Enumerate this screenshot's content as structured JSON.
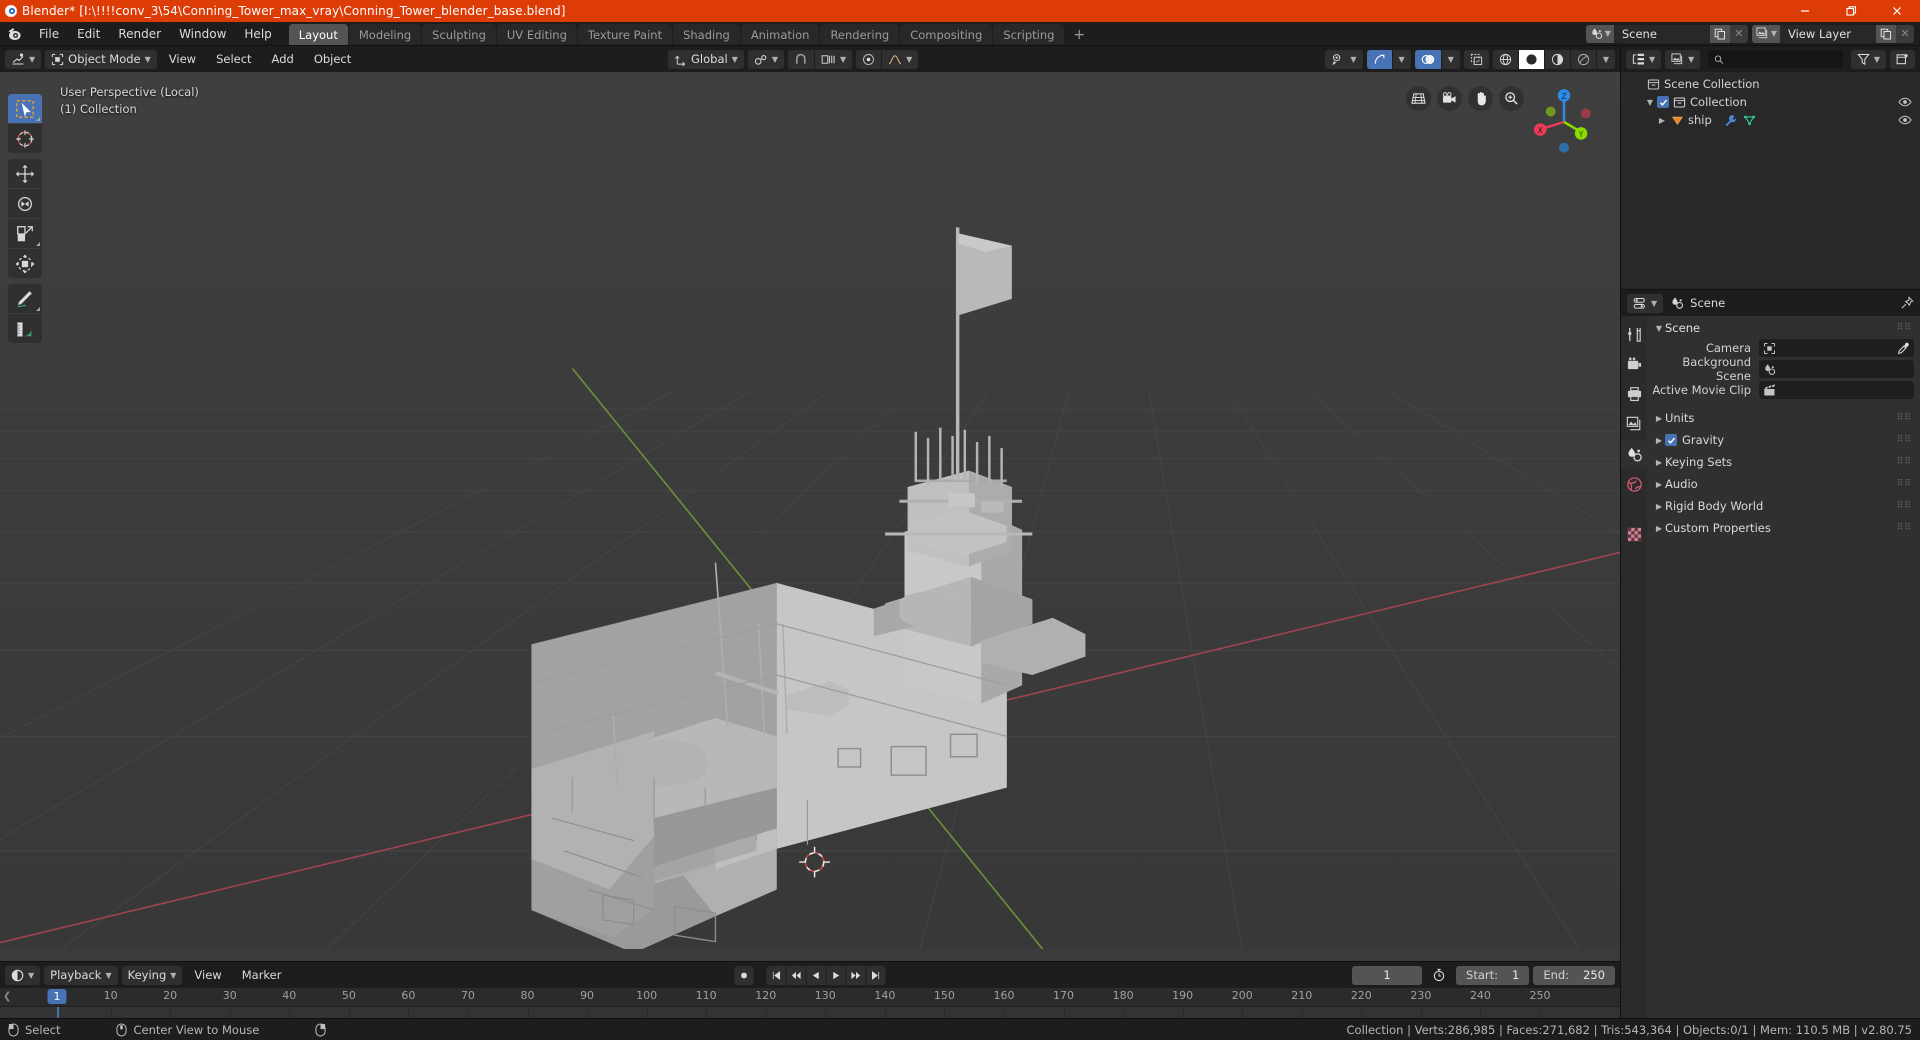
{
  "titlebar": {
    "app_title": "Blender* [I:\\!!!!conv_3\\54\\Conning_Tower_max_vray\\Conning_Tower_blender_base.blend]",
    "minimize": "minimize-icon",
    "maximize": "restore-icon",
    "close": "close-icon"
  },
  "topbar": {
    "menus": [
      "File",
      "Edit",
      "Render",
      "Window",
      "Help"
    ],
    "workspaces": [
      {
        "label": "Layout",
        "active": true
      },
      {
        "label": "Modeling",
        "active": false
      },
      {
        "label": "Sculpting",
        "active": false
      },
      {
        "label": "UV Editing",
        "active": false
      },
      {
        "label": "Texture Paint",
        "active": false
      },
      {
        "label": "Shading",
        "active": false
      },
      {
        "label": "Animation",
        "active": false
      },
      {
        "label": "Rendering",
        "active": false
      },
      {
        "label": "Compositing",
        "active": false
      },
      {
        "label": "Scripting",
        "active": false
      }
    ],
    "add_workspace": "+",
    "scene_selector": {
      "value": "Scene"
    },
    "viewlayer_selector": {
      "value": "View Layer"
    }
  },
  "viewport_header": {
    "editor_type": "editor-type-3dview",
    "mode": "Object Mode",
    "menus": [
      "View",
      "Select",
      "Add",
      "Object"
    ],
    "transform_orientation": "Global",
    "snap_enabled": false,
    "proportional_edit": false
  },
  "viewport": {
    "overlay_line1": "User Perspective (Local)",
    "overlay_line2": "(1) Collection",
    "tools": [
      {
        "name": "tweak-select-box",
        "active": true
      },
      {
        "name": "cursor",
        "active": false
      },
      {
        "name": "move",
        "active": false
      },
      {
        "name": "rotate",
        "active": false
      },
      {
        "name": "scale",
        "active": false
      },
      {
        "name": "transform",
        "active": false
      },
      {
        "name": "annotate",
        "active": false
      },
      {
        "name": "measure",
        "active": false
      }
    ],
    "nav_buttons": [
      "toggle-orthographic-icon",
      "camera-view-icon",
      "pan-view-icon",
      "zoom-view-icon"
    ],
    "gizmo_axes": [
      "X",
      "Y",
      "Z"
    ],
    "colors": {
      "x_axis": "#ec3b59",
      "y_axis": "#8bdc00",
      "z_axis": "#2e8ae5",
      "background": "#3b3b3b",
      "model": "#b5b5b5"
    }
  },
  "outliner": {
    "display_mode": "view-layer-icon",
    "filter_icon": "filter-icon",
    "new_collection_icon": "new-collection-icon",
    "search_placeholder": "",
    "rows": [
      {
        "label": "Scene Collection",
        "indent": 0,
        "icon": "collection-icon",
        "has_checkbox": false,
        "has_disclosure": false,
        "has_eye": false
      },
      {
        "label": "Collection",
        "indent": 1,
        "icon": "collection-icon",
        "has_checkbox": true,
        "has_disclosure": true,
        "has_eye": true
      },
      {
        "label": "ship",
        "indent": 2,
        "icon": "mesh-object-icon",
        "has_checkbox": false,
        "has_disclosure": true,
        "has_eye": true,
        "extra_icons": [
          "modifier-wrench-icon",
          "mesh-data-icon"
        ]
      }
    ]
  },
  "properties": {
    "editor_icon": "properties-editor-icon",
    "breadcrumb": "Scene",
    "pin_icon": "pin-icon",
    "tabs": [
      {
        "name": "tool-tab",
        "active": false
      },
      {
        "name": "render-tab",
        "active": false
      },
      {
        "name": "output-tab",
        "active": false
      },
      {
        "name": "view-layer-tab",
        "active": false
      },
      {
        "name": "scene-tab",
        "active": true
      },
      {
        "name": "world-tab",
        "active": false
      },
      {
        "name": "texture-tab",
        "active": false
      }
    ],
    "panel_title": "Scene",
    "fields": [
      {
        "label": "Camera",
        "value": "",
        "icon": "camera-icon",
        "eyedropper": true
      },
      {
        "label": "Background Scene",
        "value": "",
        "icon": "scene-icon",
        "eyedropper": false
      },
      {
        "label": "Active Movie Clip",
        "value": "",
        "icon": "movie-clip-icon",
        "eyedropper": false
      }
    ],
    "sections": [
      {
        "label": "Units",
        "checkbox": false
      },
      {
        "label": "Gravity",
        "checkbox": true,
        "checked": true
      },
      {
        "label": "Keying Sets",
        "checkbox": false
      },
      {
        "label": "Audio",
        "checkbox": false
      },
      {
        "label": "Rigid Body World",
        "checkbox": false
      },
      {
        "label": "Custom Properties",
        "checkbox": false
      }
    ]
  },
  "timeline": {
    "editor_icon": "timeline-editor-icon",
    "menus": [
      "Playback",
      "Keying",
      "View",
      "Marker"
    ],
    "playback_buttons": [
      "record-keyframes-icon",
      "jump-to-start-icon",
      "previous-keyframe-icon",
      "play-reverse-icon",
      "play-icon",
      "next-keyframe-icon",
      "jump-to-end-icon"
    ],
    "current_frame": "1",
    "auto_key_icon": "auto-keying-icon",
    "start_label": "Start:",
    "start_value": "1",
    "end_label": "End:",
    "end_value": "250",
    "ruler_ticks": [
      "10",
      "20",
      "30",
      "40",
      "50",
      "60",
      "70",
      "80",
      "90",
      "100",
      "110",
      "120",
      "130",
      "140",
      "150",
      "160",
      "170",
      "180",
      "190",
      "200",
      "210",
      "220",
      "230",
      "240",
      "250"
    ],
    "playhead_frame": "1"
  },
  "statusbar": {
    "hints": [
      {
        "icon": "mouse-left-icon",
        "label": "Select"
      },
      {
        "icon": "mouse-middle-icon",
        "label": "Center View to Mouse"
      },
      {
        "icon": "mouse-right-icon",
        "label": ""
      }
    ],
    "stats": "Collection | Verts:286,985 | Faces:271,682 | Tris:543,364 | Objects:0/1 | Mem: 110.5 MB | v2.80.75"
  }
}
